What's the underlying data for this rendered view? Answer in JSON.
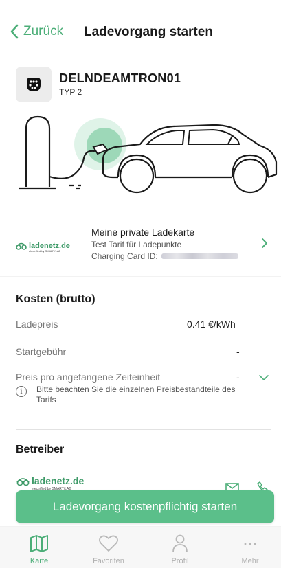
{
  "nav": {
    "back_label": "Zurück",
    "title": "Ladevorgang starten"
  },
  "station": {
    "id": "DELNDEAMTRON01",
    "type": "TYP 2",
    "plug_icon": "type2-plug-icon"
  },
  "card": {
    "brand": "ladenetz.de",
    "brand_sub": "electrified by SMART/LAB",
    "title": "Meine private Ladekarte",
    "tarif": "Test Tarif für Ladepunkte",
    "id_label": "Charging Card ID:"
  },
  "costs": {
    "title": "Kosten (brutto)",
    "rows": [
      {
        "label": "Ladepreis",
        "value": "0.41 €/kWh"
      },
      {
        "label": "Startgebühr",
        "value": "-"
      },
      {
        "label": "Preis pro angefangene Zeiteinheit",
        "value": "-"
      }
    ],
    "info": "Bitte beachten Sie die einzelnen Preisbestandteile des Tarifs"
  },
  "operator": {
    "title": "Betreiber",
    "brand": "ladenetz.de",
    "brand_sub": "electrified by SMART/LAB"
  },
  "cta_label": "Ladevorgang kostenpflichtig starten",
  "tabs": [
    {
      "label": "Karte",
      "icon": "map-icon",
      "active": true
    },
    {
      "label": "Favoriten",
      "icon": "heart-icon",
      "active": false
    },
    {
      "label": "Profil",
      "icon": "person-icon",
      "active": false
    },
    {
      "label": "Mehr",
      "icon": "more-icon",
      "active": false
    }
  ],
  "colors": {
    "accent": "#4cae78",
    "cta": "#5bbf8a"
  }
}
